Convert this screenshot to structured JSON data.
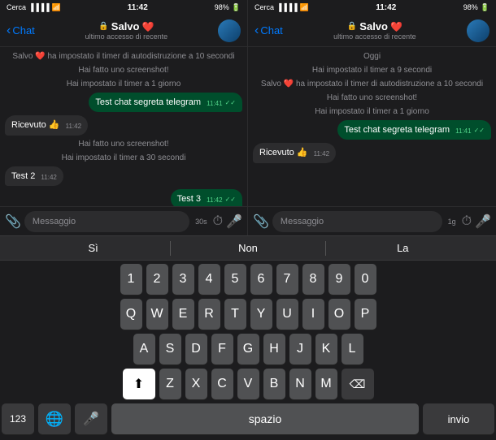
{
  "panel1": {
    "statusBar": {
      "left": "Cerca",
      "time": "11:42",
      "rightIcons": "98%"
    },
    "header": {
      "back": "Chat",
      "name": "Salvo",
      "heart": "❤️",
      "sub": "ultimo accesso di recente"
    },
    "messages": [
      {
        "type": "system",
        "text": "Salvo ❤️ ha impostato il timer di autodistruzione a 10 secondi"
      },
      {
        "type": "system",
        "text": "Hai fatto uno screenshot!"
      },
      {
        "type": "system",
        "text": "Hai impostato il timer a 1 giorno"
      },
      {
        "type": "outgoing",
        "text": "Test chat segreta telegram",
        "time": "11:41",
        "checks": "✓✓"
      },
      {
        "type": "incoming",
        "text": "Ricevuto 👍",
        "time": "11:42"
      },
      {
        "type": "system",
        "text": "Hai fatto uno screenshot!"
      },
      {
        "type": "system",
        "text": "Hai impostato il timer a 30 secondi"
      },
      {
        "type": "incoming",
        "text": "Test 2",
        "time": "11:42"
      },
      {
        "type": "outgoing",
        "text": "Test 3",
        "time": "11:42",
        "checks": "✓✓"
      }
    ],
    "inputPlaceholder": "Messaggio",
    "inputTimer": "30s"
  },
  "panel2": {
    "statusBar": {
      "left": "Cerca",
      "time": "11:42",
      "rightIcons": "98%"
    },
    "header": {
      "back": "Chat",
      "name": "Salvo",
      "heart": "❤️",
      "sub": "ultimo accesso di recente"
    },
    "messages": [
      {
        "type": "system",
        "text": "Oggi"
      },
      {
        "type": "system",
        "text": "Hai impostato il timer a 9 secondi"
      },
      {
        "type": "system",
        "text": "Salvo ❤️ ha impostato il timer di autodistruzione a 10 secondi"
      },
      {
        "type": "system",
        "text": "Hai fatto uno screenshot!"
      },
      {
        "type": "system",
        "text": "Hai impostato il timer a 1 giorno"
      },
      {
        "type": "outgoing",
        "text": "Test chat segreta telegram",
        "time": "11:41",
        "checks": "✓✓"
      },
      {
        "type": "incoming",
        "text": "Ricevuto 👍",
        "time": "11:42"
      }
    ],
    "inputPlaceholder": "Messaggio",
    "inputTimer": "1g"
  },
  "keyboard": {
    "autocomplete": [
      "Sì",
      "Non",
      "La"
    ],
    "rows": [
      [
        "Q",
        "W",
        "E",
        "R",
        "T",
        "Y",
        "U",
        "I",
        "O",
        "P"
      ],
      [
        "A",
        "S",
        "D",
        "F",
        "G",
        "H",
        "J",
        "K",
        "L"
      ],
      [
        "Z",
        "X",
        "C",
        "V",
        "B",
        "N",
        "M"
      ],
      [
        "123",
        "🌐",
        "🎤",
        "spazio",
        "invio"
      ]
    ],
    "numberRow": [
      "1",
      "2",
      "3",
      "4",
      "5",
      "6",
      "7",
      "8",
      "9",
      "0"
    ],
    "specialRow1": [
      "-",
      "/",
      ":",
      ";",
      "(",
      "€",
      "&",
      "@",
      "\""
    ],
    "specialRow2": [
      "#+=",
      ".",
      ",",
      "?",
      "!",
      "'"
    ]
  }
}
